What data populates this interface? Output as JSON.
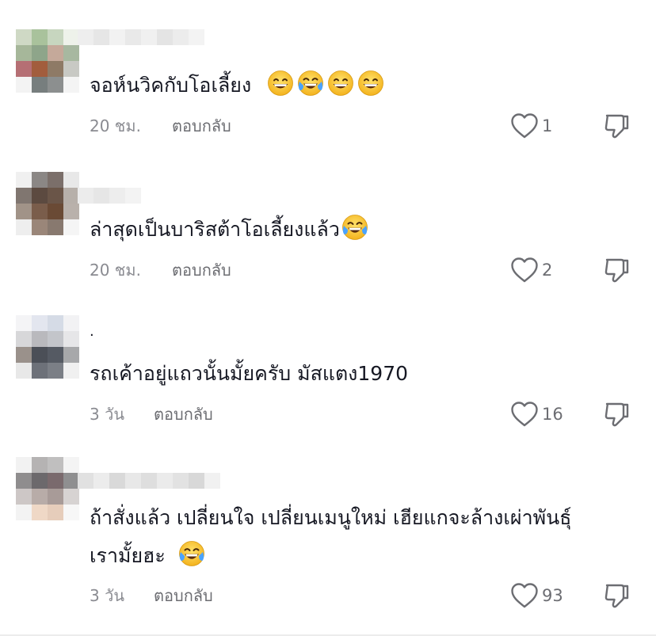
{
  "comments": [
    {
      "text": "จอห์นวิคกับโอเลี้ยง",
      "time": "20 ชม.",
      "reply_label": "ตอบกลับ",
      "likes": "1",
      "emojis": [
        "grinning-face",
        "tears-of-joy",
        "grinning-face",
        "grinning-face"
      ]
    },
    {
      "text": "ล่าสุดเป็นบาริสต้าโอเลี้ยงแล้ว",
      "time": "20 ชม.",
      "reply_label": "ตอบกลับ",
      "likes": "2",
      "emojis": [
        "tears-of-joy"
      ]
    },
    {
      "display_name": ".",
      "text": "รถเค้าอยู่แถวนั้นมั้ยครับ มัสแตง1970",
      "time": "3 วัน",
      "reply_label": "ตอบกลับ",
      "likes": "16",
      "emojis": []
    },
    {
      "text_line1": "ถ้าสั่งแล้ว เปลี่ยนใจ เปลี่ยนเมนูใหม่ เฮียแกจะล้างเผ่าพันธุ์",
      "text_line2": "เรามั้ยฮะ",
      "time": "3 วัน",
      "reply_label": "ตอบกลับ",
      "likes": "93",
      "emojis": [
        "tears-of-joy"
      ]
    }
  ],
  "icons": {
    "like": "heart-outline-icon",
    "dislike": "thumbs-down-outline-icon"
  },
  "colors": {
    "text": "#161823",
    "meta": "#8a8b91",
    "icon": "#6c6d72",
    "emoji_face": "#f9c62b",
    "tears": "#4aa3ff"
  }
}
